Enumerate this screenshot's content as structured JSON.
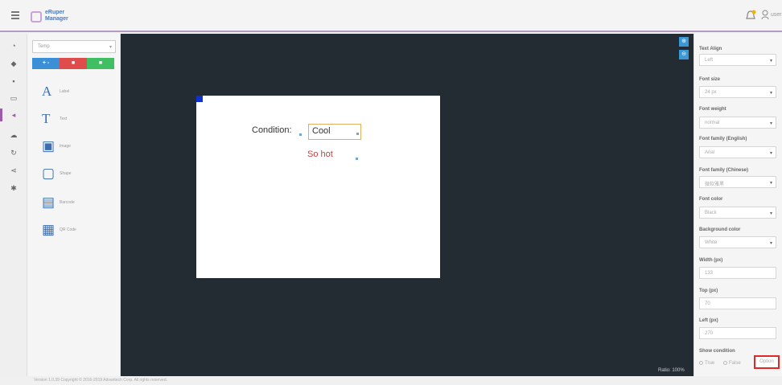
{
  "topbar": {
    "logo_line1": "eRuper",
    "logo_line2": "Manager",
    "user_label": "user"
  },
  "rail": {
    "icons": [
      "gauge-icon",
      "tag-icon",
      "print-icon",
      "monitor-icon",
      "signal-icon",
      "cloud-icon",
      "refresh-icon",
      "share-icon",
      "gear-icon"
    ]
  },
  "widgets": {
    "select_value": "Temp",
    "buttons": {
      "add": "+ -",
      "delete": "■",
      "save": "■"
    },
    "items": [
      {
        "icon": "A",
        "label": "Label"
      },
      {
        "icon": "T",
        "label": "Text"
      },
      {
        "icon": "▣",
        "label": "Image"
      },
      {
        "icon": "▢",
        "label": "Shape"
      },
      {
        "icon": "▤",
        "label": "Barcode"
      },
      {
        "icon": "▦",
        "label": "QR Code"
      }
    ]
  },
  "canvas": {
    "zoom_text": "Ratio: 100%",
    "condition_label": "Condition:",
    "condition_value": "Cool",
    "alt_text": "So hot"
  },
  "props": {
    "text_align_label": "Text Align",
    "text_align_value": "Left",
    "font_size_label": "Font size",
    "font_size_value": "24 px",
    "font_weight_label": "Font weight",
    "font_weight_value": "normal",
    "font_family_en_label": "Font family (English)",
    "font_family_en_value": "Arial",
    "font_family_cn_label": "Font family (Chinese)",
    "font_family_cn_value": "微软雅黑",
    "font_color_label": "Font color",
    "font_color_value": "Black",
    "bg_color_label": "Background color",
    "bg_color_value": "White",
    "width_label": "Width (px)",
    "width_value": "133",
    "top_label": "Top (px)",
    "top_value": "70",
    "left_label": "Left (px)",
    "left_value": "270",
    "show_condition_label": "Show condition",
    "radio_true": "True",
    "radio_false": "False",
    "option_button": "Option"
  },
  "footer": {
    "text": "Version 1.0.39 Copyright © 2016-2019 Advantech Corp. All rights reserved."
  }
}
